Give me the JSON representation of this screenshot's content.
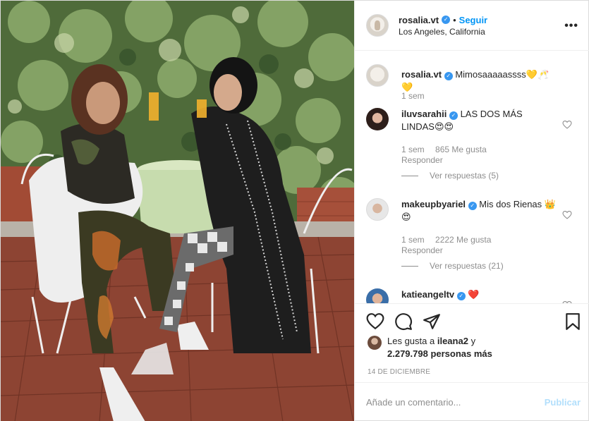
{
  "post": {
    "username": "rosalia.vt",
    "verified_icon": "verified-badge-icon",
    "separator": "•",
    "follow_label": "Seguir",
    "location": "Los Angeles, California",
    "more_icon": "more-options-icon",
    "more_label": "•••"
  },
  "caption": {
    "username": "rosalia.vt",
    "text": "Mimosaaaaassss💛🥂💛",
    "time": "1 sem"
  },
  "comments": [
    {
      "username": "iluvsarahii",
      "text": "LAS DOS MÁS LINDAS😍😍",
      "time": "1 sem",
      "likes": "865 Me gusta",
      "reply": "Responder",
      "view_replies": "Ver respuestas (5)"
    },
    {
      "username": "makeupbyariel",
      "text": "Mis dos Rienas 👑😍",
      "time": "1 sem",
      "likes": "2222 Me gusta",
      "reply": "Responder",
      "view_replies": "Ver respuestas (21)"
    },
    {
      "username": "katieangeltv",
      "text": "❤️"
    }
  ],
  "actions": {
    "like_icon": "heart-icon",
    "comment_icon": "comment-icon",
    "share_icon": "share-icon",
    "save_icon": "bookmark-icon"
  },
  "likes": {
    "prefix": "Les gusta a",
    "user": "ileana2",
    "conj": "y",
    "others": "2.279.798 personas más"
  },
  "date": "14 DE DICIEMBRE",
  "compose": {
    "placeholder": "Añade un comentario...",
    "publish_label": "Publicar"
  },
  "colors": {
    "link_blue": "#0095f6",
    "publish_disabled": "#b2dffc",
    "verified": "#3897f0",
    "muted": "#8e8e8e"
  }
}
